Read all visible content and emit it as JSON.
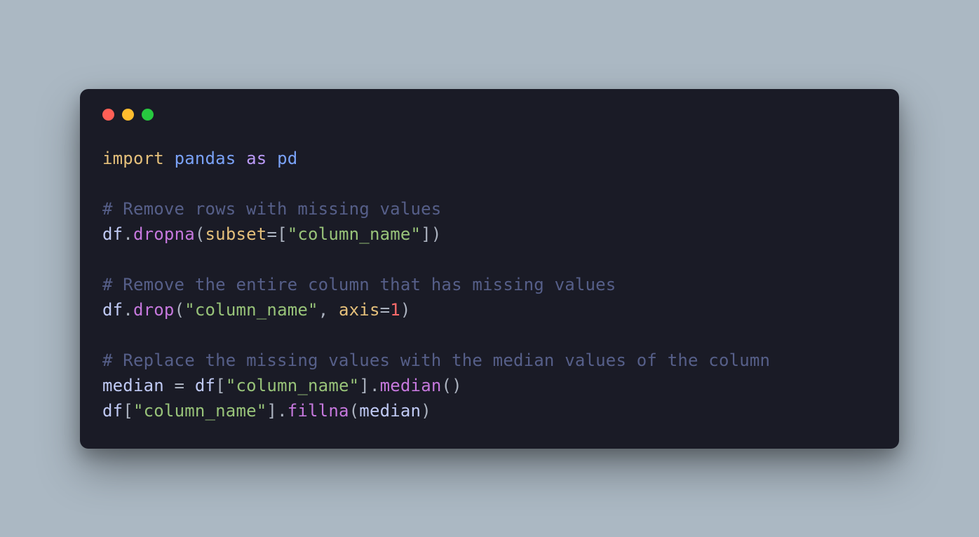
{
  "code": {
    "line1": {
      "import": "import",
      "module": "pandas",
      "as": "as",
      "alias": "pd"
    },
    "line3": {
      "comment": "# Remove rows with missing values"
    },
    "line4": {
      "obj": "df",
      "dot1": ".",
      "method": "dropna",
      "lparen": "(",
      "param": "subset",
      "eq": "=",
      "lbracket": "[",
      "str": "\"column_name\"",
      "rbracket": "]",
      "rparen": ")"
    },
    "line6": {
      "comment": "# Remove the entire column that has missing values"
    },
    "line7": {
      "obj": "df",
      "dot1": ".",
      "method": "drop",
      "lparen": "(",
      "str": "\"column_name\"",
      "comma": ", ",
      "param": "axis",
      "eq": "=",
      "num": "1",
      "rparen": ")"
    },
    "line9": {
      "comment": "# Replace the missing values with the median values of the column"
    },
    "line10": {
      "var": "median",
      "eq": " = ",
      "obj": "df",
      "lbracket": "[",
      "str": "\"column_name\"",
      "rbracket": "]",
      "dot": ".",
      "method": "median",
      "parens": "()"
    },
    "line11": {
      "obj": "df",
      "lbracket": "[",
      "str": "\"column_name\"",
      "rbracket": "]",
      "dot": ".",
      "method": "fillna",
      "lparen": "(",
      "arg": "median",
      "rparen": ")"
    }
  }
}
